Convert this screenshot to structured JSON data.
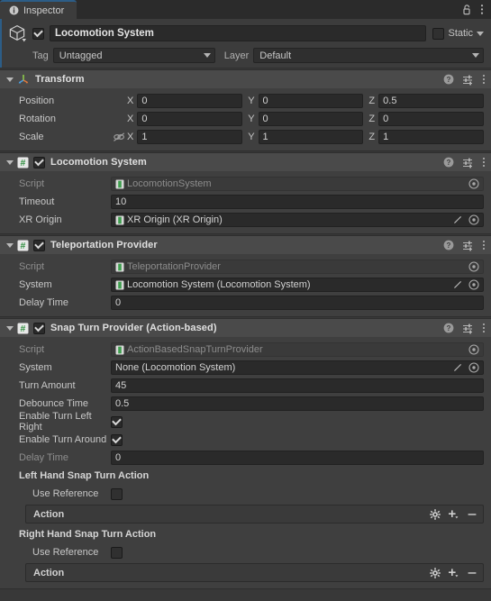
{
  "window": {
    "tab_label": "Inspector",
    "tab_icon": "info-icon",
    "lock_icon": "lock-open-icon",
    "menu_icon": "kebab-menu-icon",
    "accent_color": "#2c5d87",
    "panel_bg": "#383838",
    "component_bg": "#3f3f3f",
    "header_bg": "#4a4a4a"
  },
  "gameobject": {
    "enabled": true,
    "name": "Locomotion System",
    "icon": "gameobject-cube-icon",
    "static_label": "Static",
    "static_checked": false,
    "tag_label": "Tag",
    "tag_value": "Untagged",
    "layer_label": "Layer",
    "layer_value": "Default"
  },
  "components": [
    {
      "title": "Transform",
      "icon": "transform-axis-icon",
      "has_enable_checkbox": false,
      "expanded": true,
      "vectors": [
        {
          "label": "Position",
          "x": "0",
          "y": "0",
          "z": "0.5",
          "lock": false
        },
        {
          "label": "Rotation",
          "x": "0",
          "y": "0",
          "z": "0",
          "lock": false
        },
        {
          "label": "Scale",
          "x": "1",
          "y": "1",
          "z": "1",
          "lock": true
        }
      ],
      "axes": [
        "X",
        "Y",
        "Z"
      ]
    },
    {
      "title": "Locomotion System",
      "icon": "script-hash-icon",
      "has_enable_checkbox": true,
      "enabled": true,
      "expanded": true,
      "fields": [
        {
          "label": "Script",
          "value": "LocomotionSystem",
          "type": "object-readonly",
          "obj_icon": true,
          "icons": [
            "target-select-icon"
          ]
        },
        {
          "label": "Timeout",
          "value": "10",
          "type": "text",
          "icons": []
        },
        {
          "label": "XR Origin",
          "value": "XR Origin (XR Origin)",
          "type": "object",
          "obj_icon": true,
          "icons": [
            "edit-pencil-icon",
            "target-select-icon"
          ]
        }
      ]
    },
    {
      "title": "Teleportation Provider",
      "icon": "script-hash-icon",
      "has_enable_checkbox": true,
      "enabled": true,
      "expanded": true,
      "fields": [
        {
          "label": "Script",
          "value": "TeleportationProvider",
          "type": "object-readonly",
          "obj_icon": true,
          "icons": [
            "target-select-icon"
          ]
        },
        {
          "label": "System",
          "value": "Locomotion System (Locomotion System)",
          "type": "object",
          "obj_icon": true,
          "icons": [
            "edit-pencil-icon",
            "target-select-icon"
          ]
        },
        {
          "label": "Delay Time",
          "value": "0",
          "type": "text",
          "icons": []
        }
      ]
    },
    {
      "title": "Snap Turn Provider (Action-based)",
      "icon": "script-hash-icon",
      "has_enable_checkbox": true,
      "enabled": true,
      "expanded": true,
      "fields": [
        {
          "label": "Script",
          "value": "ActionBasedSnapTurnProvider",
          "type": "object-readonly",
          "obj_icon": true,
          "icons": [
            "target-select-icon"
          ]
        },
        {
          "label": "System",
          "value": "None (Locomotion System)",
          "type": "object",
          "obj_icon": false,
          "icons": [
            "edit-pencil-icon",
            "target-select-icon"
          ]
        },
        {
          "label": "Turn Amount",
          "value": "45",
          "type": "text",
          "icons": []
        },
        {
          "label": "Debounce Time",
          "value": "0.5",
          "type": "text",
          "icons": []
        },
        {
          "label": "Enable Turn Left Right",
          "value": true,
          "type": "checkbox"
        },
        {
          "label": "Enable Turn Around",
          "value": true,
          "type": "checkbox"
        },
        {
          "label": "Delay Time",
          "value": "0",
          "type": "text",
          "dim": true,
          "icons": []
        },
        {
          "label": "Left Hand Snap Turn Action",
          "type": "header"
        },
        {
          "label": "Use Reference",
          "value": false,
          "type": "checkbox-indent"
        },
        {
          "label": "Action",
          "type": "action",
          "icons": [
            "gear-icon",
            "plus-dropdown-icon",
            "minus-icon"
          ]
        },
        {
          "label": "Right Hand Snap Turn Action",
          "type": "header"
        },
        {
          "label": "Use Reference",
          "value": false,
          "type": "checkbox-indent"
        },
        {
          "label": "Action",
          "type": "action",
          "icons": [
            "gear-icon",
            "plus-dropdown-icon",
            "minus-icon"
          ]
        }
      ]
    }
  ]
}
